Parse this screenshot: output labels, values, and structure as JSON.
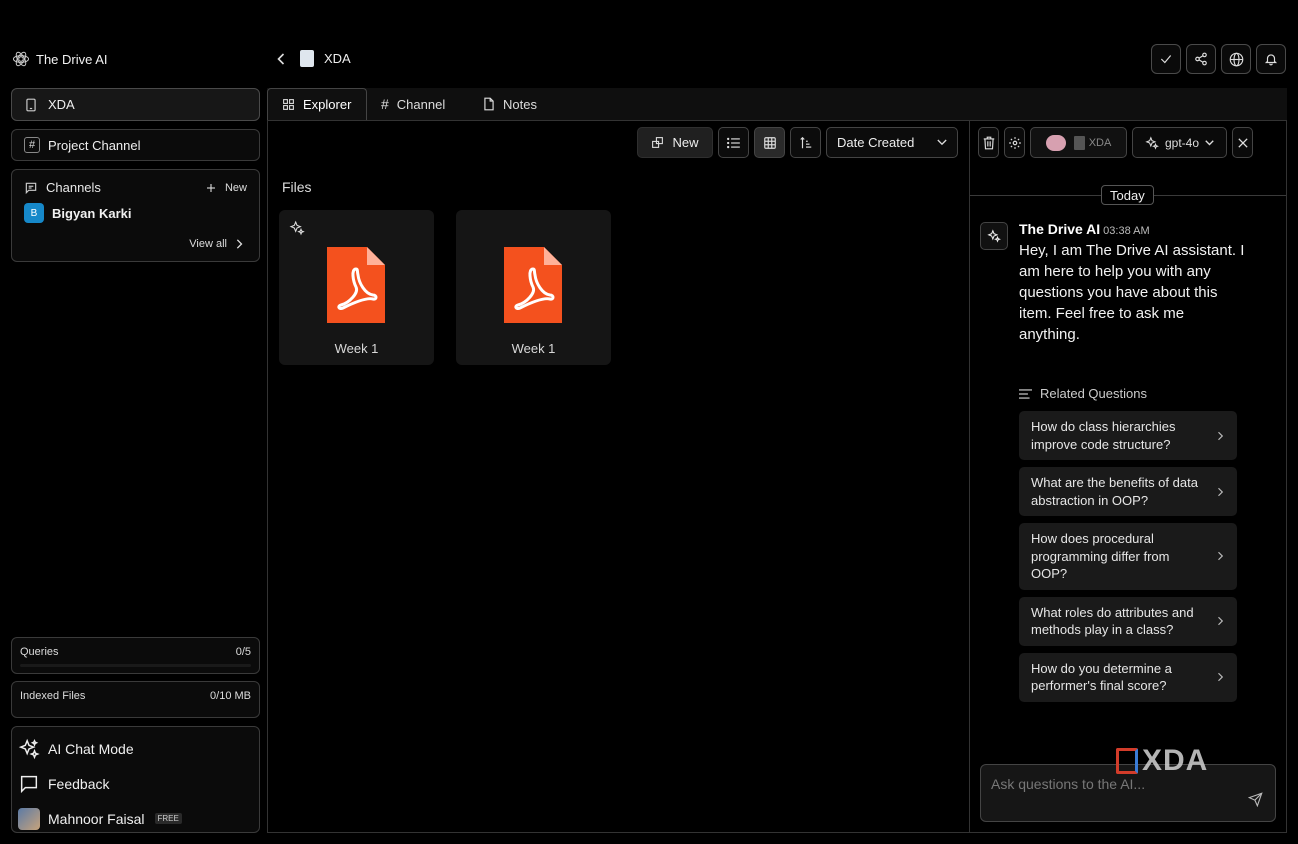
{
  "brand": {
    "name": "The Drive AI"
  },
  "sidebar": {
    "workspace": "XDA",
    "project_channel": "Project Channel",
    "channels_title": "Channels",
    "new_label": "New",
    "member_initial": "B",
    "member_name": "Bigyan Karki",
    "view_all": "View all",
    "queries_label": "Queries",
    "queries_value": "0/5",
    "indexed_label": "Indexed Files",
    "indexed_value": "0/10 MB",
    "ai_chat_mode": "AI Chat Mode",
    "feedback": "Feedback",
    "user_name": "Mahnoor Faisal",
    "plan_badge": "FREE"
  },
  "header": {
    "breadcrumb": "XDA"
  },
  "tabs": [
    {
      "label": "Explorer"
    },
    {
      "label": "Channel"
    },
    {
      "label": "Notes"
    }
  ],
  "explorer": {
    "new_label": "New",
    "sort_label": "Date Created",
    "files_title": "Files",
    "files": [
      {
        "name": "Week 1"
      },
      {
        "name": "Week 1"
      }
    ]
  },
  "chat": {
    "context_label": "XDA",
    "model": "gpt-4o",
    "date_label": "Today",
    "bot_name": "The Drive AI",
    "bot_time": "03:38 AM",
    "bot_message": "Hey, I am The Drive AI assistant. I am here to help you with any questions you have about this item. Feel free to ask me anything.",
    "related_title": "Related Questions",
    "related": [
      "How do class hierarchies improve code structure?",
      "What are the benefits of data abstraction in OOP?",
      "How does procedural programming differ from OOP?",
      "What roles do attributes and methods play in a class?",
      "How do you determine a performer's final score?"
    ],
    "input_placeholder": "Ask questions to the AI..."
  },
  "watermark": {
    "text": "XDA"
  },
  "colors": {
    "pdf": "#f4511e",
    "accent_blue": "#1688c9",
    "background": "#000000"
  }
}
